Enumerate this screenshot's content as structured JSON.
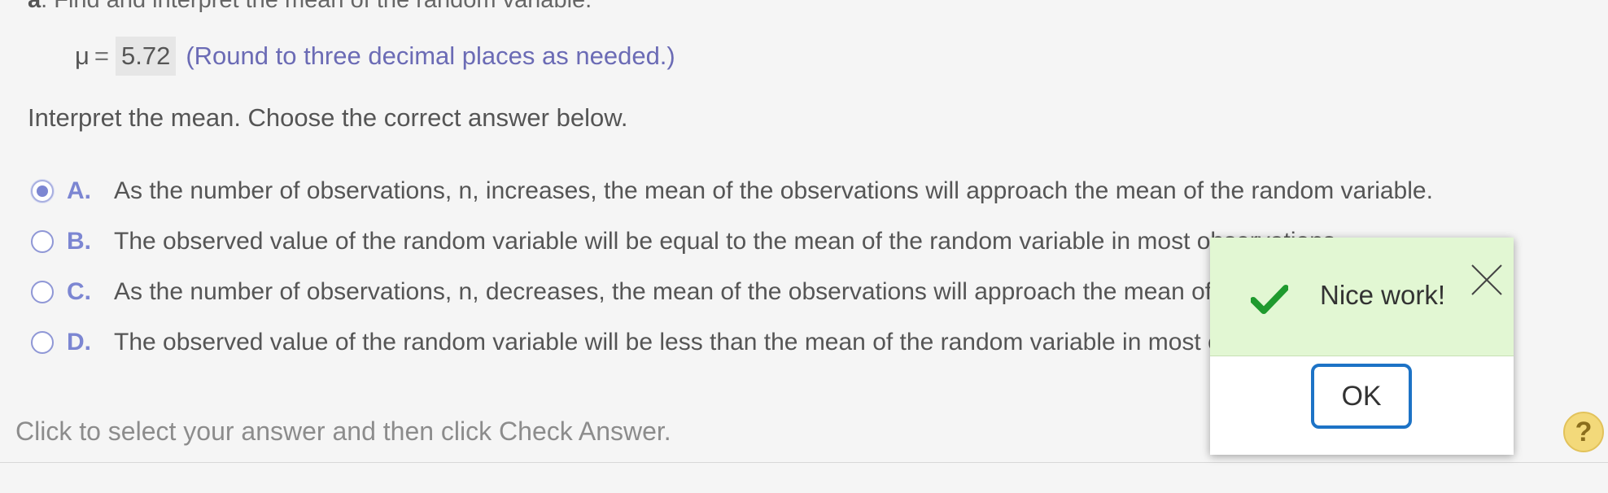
{
  "question": {
    "part_letter": "a",
    "part_text": ". Find and interpret the mean of the random variable."
  },
  "mean_answer": {
    "symbol": "μ",
    "equals": "=",
    "value": "5.72",
    "note": "(Round to three decimal places as needed.)"
  },
  "interpret_prompt": "Interpret the mean. Choose the correct answer below.",
  "options": [
    {
      "letter": "A.",
      "text": "As the number of observations, n, increases, the mean of the observations will approach the mean of the random variable.",
      "selected": true
    },
    {
      "letter": "B.",
      "text": "The observed value of the random variable will be equal to the mean of the random variable in most observations.",
      "selected": false
    },
    {
      "letter": "C.",
      "text": "As the number of observations, n, decreases, the mean of the observations will approach the mean of the random variable.",
      "selected": false
    },
    {
      "letter": "D.",
      "text": "The observed value of the random variable will be less than the mean of the random variable in most observations.",
      "selected": false
    }
  ],
  "footer": {
    "instruction": "Click to select your answer and then click Check Answer.",
    "help_label": "?"
  },
  "popup": {
    "message": "Nice work!",
    "ok_label": "OK"
  },
  "colors": {
    "accent": "#7c86d2",
    "success_bg": "#e2f7d3",
    "check_green": "#1f9a2e",
    "ok_border": "#1d73c6"
  }
}
